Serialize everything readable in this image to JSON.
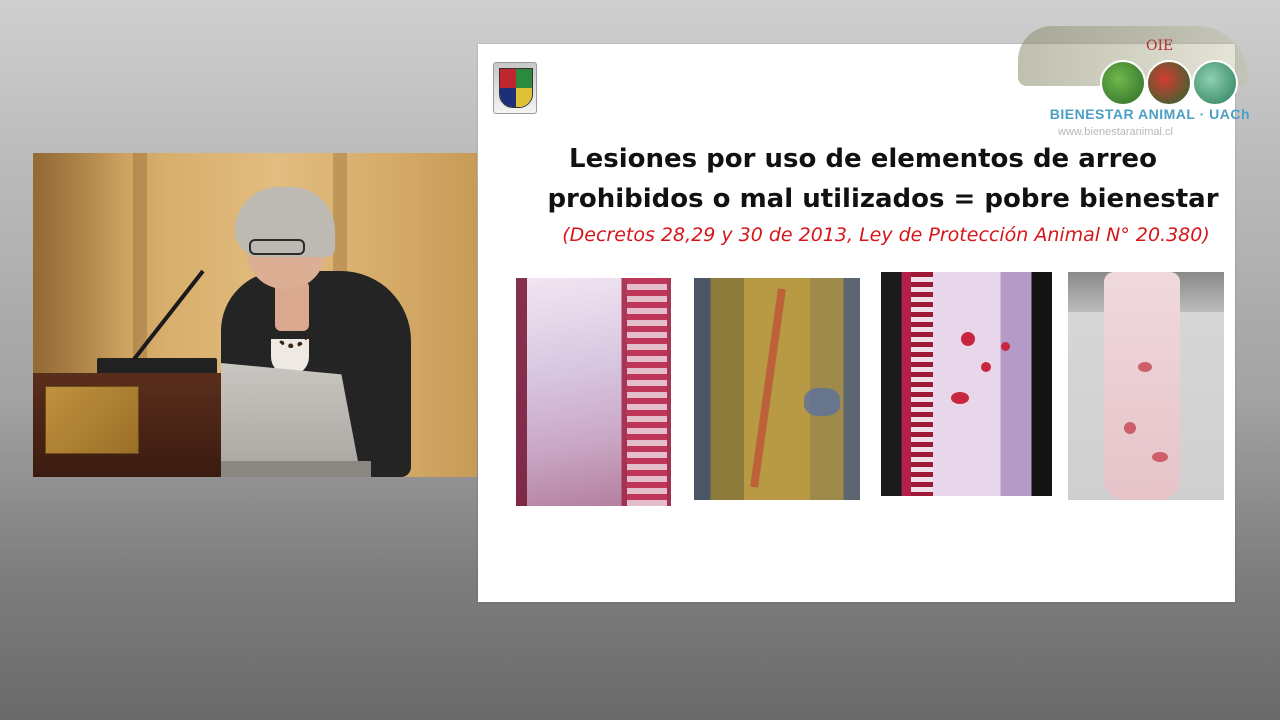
{
  "slide": {
    "title_line1": "Lesiones por uso de elementos de arreo",
    "title_line2": "prohibidos o mal utilizados = pobre bienestar",
    "subtitle": "(Decretos 28,29 y 30 de 2013, Ley de Protección Animal N° 20.380)",
    "photos": [
      {
        "name": "carcass-photo-1"
      },
      {
        "name": "carcass-photo-2"
      },
      {
        "name": "carcass-photo-3"
      },
      {
        "name": "carcass-photo-4"
      }
    ]
  },
  "logo": {
    "org": "OIE",
    "brand": "BIENESTAR ANIMAL · UACh",
    "url": "www.bienestaranimal.cl"
  },
  "video": {
    "scene": "speaker-at-podium"
  },
  "colors": {
    "subtitle": "#d6161a",
    "brand": "#4b9fc4",
    "slide_bg": "#ffffff"
  }
}
